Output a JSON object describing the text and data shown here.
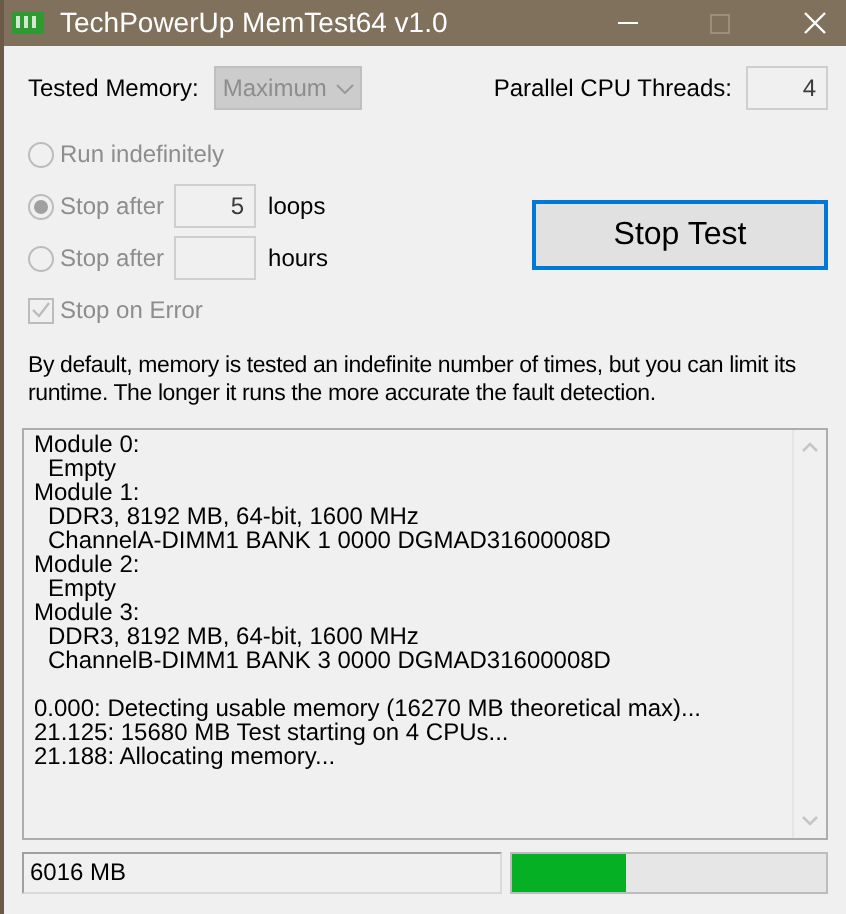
{
  "window": {
    "title": "TechPowerUp MemTest64 v1.0"
  },
  "tested_memory": {
    "label": "Tested Memory:",
    "value": "Maximum",
    "disabled": true
  },
  "threads": {
    "label": "Parallel CPU Threads:",
    "value": "4"
  },
  "options": [
    {
      "kind": "radio",
      "label": "Run indefinitely",
      "selected": false,
      "disabled": true
    },
    {
      "kind": "radio",
      "label": "Stop after",
      "value": "5",
      "unit": "loops",
      "selected": true,
      "disabled": true
    },
    {
      "kind": "radio",
      "label": "Stop after",
      "unit": "hours",
      "selected": false,
      "disabled": true
    }
  ],
  "stop_on_error": {
    "label": "Stop on Error",
    "checked": true,
    "disabled": true
  },
  "stop_button": "Stop Test",
  "description": "By default, memory is tested an indefinite number of times, but you can limit its runtime. The longer it runs the more accurate the fault detection.",
  "log": {
    "modules": [
      {
        "text": "Module 0:",
        "children": [
          {
            "text": "Empty"
          }
        ]
      },
      {
        "text": "Module 1:",
        "children": [
          {
            "text": "DDR3, 8192 MB, 64-bit, 1600 MHz"
          },
          {
            "text": "ChannelA-DIMM1 BANK 1 0000 DGMAD31600008D"
          }
        ]
      },
      {
        "text": "Module 2:",
        "children": [
          {
            "text": "Empty"
          }
        ]
      },
      {
        "text": "Module 3:",
        "children": [
          {
            "text": "DDR3, 8192 MB, 64-bit, 1600 MHz"
          },
          {
            "text": "ChannelB-DIMM1 BANK 3 0000 DGMAD31600008D"
          }
        ]
      }
    ],
    "messages": [
      "0.000: Detecting usable memory (16270 MB theoretical max)...",
      "21.125: 15680 MB Test starting on 4 CPUs...",
      "21.188: Allocating memory..."
    ]
  },
  "status": {
    "value": "6016 MB"
  },
  "progress": {
    "level": 0.36
  }
}
